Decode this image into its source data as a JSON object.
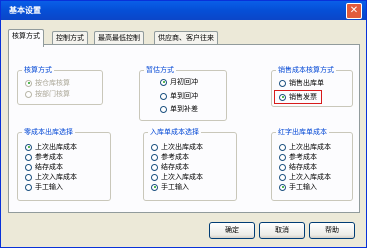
{
  "window": {
    "title": "基本设置",
    "close_glyph": "✕"
  },
  "tabs": [
    {
      "label": "核算方式",
      "active": true
    },
    {
      "label": "控制方式"
    },
    {
      "label": "最高最低控制"
    },
    {
      "label": "供应商、客户往来"
    }
  ],
  "groups": {
    "accounting_method": {
      "title": "核算方式",
      "options": [
        {
          "label": "按仓库核算",
          "selected": true,
          "disabled": true
        },
        {
          "label": "按部门核算",
          "selected": false,
          "disabled": true
        }
      ]
    },
    "posting_method": {
      "title": "暂估方式",
      "options": [
        {
          "label": "月初回冲",
          "selected": true
        },
        {
          "label": "单到回冲",
          "selected": false
        },
        {
          "label": "单到补差",
          "selected": false
        }
      ]
    },
    "sales_cost_basis": {
      "title": "销售成本核算方式",
      "options": [
        {
          "label": "销售出库单",
          "selected": false
        },
        {
          "label": "销售发票",
          "selected": true
        }
      ]
    },
    "scrap_outbound": {
      "title": "零成本出库选择",
      "options": [
        {
          "label": "上次出库成本",
          "selected": true
        },
        {
          "label": "参考成本",
          "selected": false
        },
        {
          "label": "结存成本",
          "selected": false
        },
        {
          "label": "上次入库成本",
          "selected": false
        },
        {
          "label": "手工输入",
          "selected": false
        }
      ]
    },
    "inbound_cost": {
      "title": "入库单成本选择",
      "options": [
        {
          "label": "上次出库成本",
          "selected": false
        },
        {
          "label": "参考成本",
          "selected": false
        },
        {
          "label": "结存成本",
          "selected": false
        },
        {
          "label": "上次入库成本",
          "selected": false
        },
        {
          "label": "手工输入",
          "selected": true
        }
      ]
    },
    "red_outbound_cost": {
      "title": "红字出库单成本",
      "options": [
        {
          "label": "上次出库成本",
          "selected": false
        },
        {
          "label": "参考成本",
          "selected": false
        },
        {
          "label": "结存成本",
          "selected": false
        },
        {
          "label": "上次入库成本",
          "selected": false
        },
        {
          "label": "手工输入",
          "selected": true
        }
      ]
    }
  },
  "buttons": {
    "ok": "确定",
    "cancel": "取消",
    "help": "帮助"
  },
  "colors": {
    "title_bar": "#0550d8",
    "highlight": "#d81b1b",
    "group_title": "#0046d5"
  }
}
